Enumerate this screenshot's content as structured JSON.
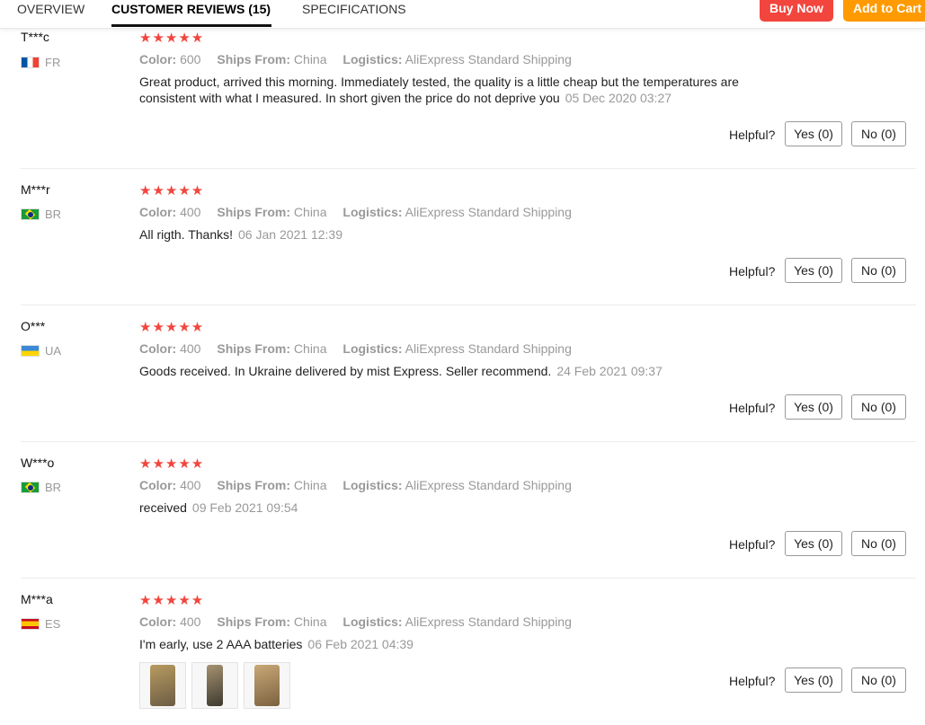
{
  "tabs": {
    "overview": "OVERVIEW",
    "reviews": "CUSTOMER REVIEWS (15)",
    "specs": "SPECIFICATIONS"
  },
  "actions": {
    "buy_now": "Buy Now",
    "add_to_cart": "Add to Cart"
  },
  "labels": {
    "color": "Color:",
    "ships_from": "Ships From:",
    "logistics": "Logistics:",
    "helpful": "Helpful?"
  },
  "stars_glyph": "★★★★★",
  "reviews": [
    {
      "user": "T***c",
      "country": "FR",
      "flag": "flag-fr",
      "rating": 5,
      "color": "600",
      "ships_from": "China",
      "logistics": "AliExpress Standard Shipping",
      "text": "Great product, arrived this morning. Immediately tested, the quality is a little cheap but the temperatures are consistent with what I measured. In short given the price do not deprive you",
      "date": "05 Dec 2020 03:27",
      "yes": "Yes (0)",
      "no": "No (0)"
    },
    {
      "user": "M***r",
      "country": "BR",
      "flag": "flag-br",
      "rating": 5,
      "color": "400",
      "ships_from": "China",
      "logistics": "AliExpress Standard Shipping",
      "text": "All rigth. Thanks!",
      "date": "06 Jan 2021 12:39",
      "yes": "Yes (0)",
      "no": "No (0)"
    },
    {
      "user": "O***",
      "country": "UA",
      "flag": "flag-ua",
      "rating": 5,
      "color": "400",
      "ships_from": "China",
      "logistics": "AliExpress Standard Shipping",
      "text": "Goods received. In Ukraine delivered by mist Express. Seller recommend.",
      "date": "24 Feb 2021 09:37",
      "yes": "Yes (0)",
      "no": "No (0)"
    },
    {
      "user": "W***o",
      "country": "BR",
      "flag": "flag-br",
      "rating": 5,
      "color": "400",
      "ships_from": "China",
      "logistics": "AliExpress Standard Shipping",
      "text": "received",
      "date": "09 Feb 2021 09:54",
      "yes": "Yes (0)",
      "no": "No (0)"
    },
    {
      "user": "M***a",
      "country": "ES",
      "flag": "flag-es",
      "rating": 5,
      "color": "400",
      "ships_from": "China",
      "logistics": "AliExpress Standard Shipping",
      "text": "I'm early, use 2 AAA batteries",
      "date": "06 Feb 2021 04:39",
      "yes": "Yes (0)",
      "no": "No (0)",
      "photos": 3
    }
  ],
  "colors": {
    "star": "#f2453d",
    "buy_now": "#f2453d",
    "add_to_cart": "#ff9a00"
  }
}
